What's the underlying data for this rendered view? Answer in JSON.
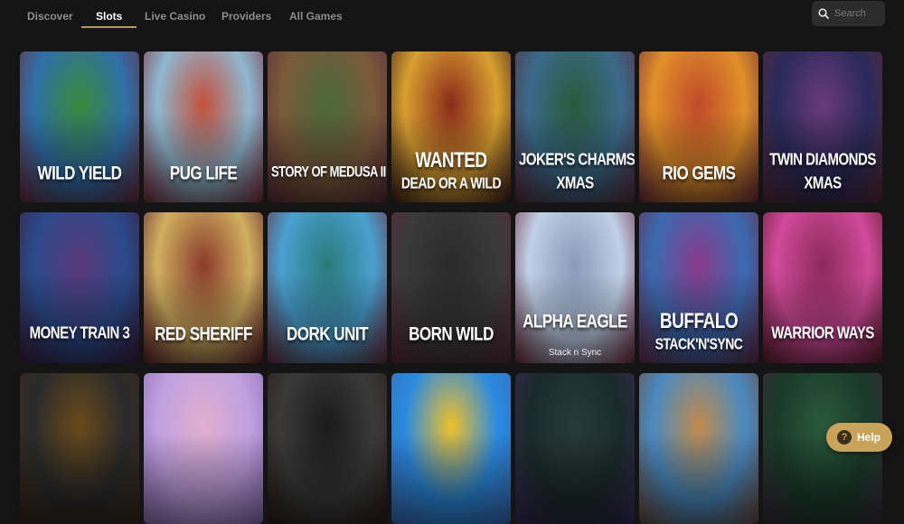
{
  "nav": {
    "tabs": [
      {
        "label": "Discover"
      },
      {
        "label": "Slots"
      },
      {
        "label": "Live Casino"
      },
      {
        "label": "Providers"
      },
      {
        "label": "All Games"
      }
    ],
    "active_tab": "Slots"
  },
  "search": {
    "placeholder": "Search",
    "icon": "search-icon"
  },
  "games": [
    {
      "line1": "WILD YIELD",
      "line2": "",
      "sub": "",
      "colors": [
        "#2f6fa8",
        "#3a8a3a",
        "#6a2a3a"
      ]
    },
    {
      "line1": "PUG LIFE",
      "line2": "",
      "sub": "",
      "colors": [
        "#8fb8d0",
        "#c4503a",
        "#7a2a3a"
      ]
    },
    {
      "line1": "STORY OF MEDUSA II",
      "line2": "",
      "sub": "",
      "colors": [
        "#7a5a3a",
        "#4a6a3a",
        "#5a2a3a"
      ]
    },
    {
      "line1": "WANTED",
      "line2": "DEAD OR A WILD",
      "sub": "",
      "colors": [
        "#d8a030",
        "#8a2a1a",
        "#3a1a1a"
      ]
    },
    {
      "line1": "JOKER'S CHARMS",
      "line2": "XMAS",
      "sub": "",
      "colors": [
        "#3a6a8a",
        "#2a5a3a",
        "#5a2a3a"
      ]
    },
    {
      "line1": "RIO GEMS",
      "line2": "",
      "sub": "",
      "colors": [
        "#e0902a",
        "#c04a2a",
        "#6a2a3a"
      ]
    },
    {
      "line1": "TWIN DIAMONDS",
      "line2": "XMAS",
      "sub": "",
      "colors": [
        "#2a2a5a",
        "#6a3a7a",
        "#5a2a3a"
      ]
    },
    {
      "line1": "MONEY TRAIN 3",
      "line2": "",
      "sub": "",
      "colors": [
        "#2a4a8a",
        "#5a3a7a",
        "#3a1a3a"
      ]
    },
    {
      "line1": "RED SHERIFF",
      "line2": "",
      "sub": "",
      "colors": [
        "#d0b060",
        "#8a3a2a",
        "#5a1a2a"
      ]
    },
    {
      "line1": "DORK UNIT",
      "line2": "",
      "sub": "",
      "colors": [
        "#4aa0d0",
        "#2a7a7a",
        "#6a2a3a"
      ]
    },
    {
      "line1": "BORN WILD",
      "line2": "",
      "sub": "",
      "colors": [
        "#3a3a3a",
        "#2a2a2a",
        "#5a2a3a"
      ]
    },
    {
      "line1": "ALPHA EAGLE",
      "line2": "",
      "sub": "Stack n Sync",
      "colors": [
        "#c0d0e8",
        "#8a9ab8",
        "#6a2a3a"
      ]
    },
    {
      "line1": "BUFFALO",
      "line2": "STACK'N'SYNC",
      "sub": "",
      "colors": [
        "#3a6ab0",
        "#8a3a8a",
        "#6a2a4a"
      ]
    },
    {
      "line1": "WARRIOR WAYS",
      "line2": "",
      "sub": "",
      "colors": [
        "#d04a9a",
        "#8a2a5a",
        "#5a1a2a"
      ]
    },
    {
      "line1": "",
      "line2": "",
      "sub": "",
      "colors": [
        "#2a2a2a",
        "#6a4a1a",
        "#3a2a1a"
      ]
    },
    {
      "line1": "",
      "line2": "",
      "sub": "",
      "colors": [
        "#c0a0e0",
        "#e0b0d0",
        "#8a6ab0"
      ]
    },
    {
      "line1": "",
      "line2": "",
      "sub": "",
      "colors": [
        "#3a3a3a",
        "#1a1a1a",
        "#2a1a1a"
      ]
    },
    {
      "line1": "",
      "line2": "",
      "sub": "",
      "colors": [
        "#2a8ae0",
        "#f0c02a",
        "#3a6ab0"
      ]
    },
    {
      "line1": "",
      "line2": "",
      "sub": "",
      "colors": [
        "#1a2a2a",
        "#2a3a3a",
        "#3a2a5a"
      ]
    },
    {
      "line1": "",
      "line2": "",
      "sub": "",
      "colors": [
        "#4a8ac0",
        "#c08a4a",
        "#6a4a3a"
      ]
    },
    {
      "line1": "",
      "line2": "",
      "sub": "",
      "colors": [
        "#1a3a2a",
        "#2a5a3a",
        "#3a2a3a"
      ]
    }
  ],
  "help": {
    "label": "Help",
    "icon": "question-icon"
  }
}
